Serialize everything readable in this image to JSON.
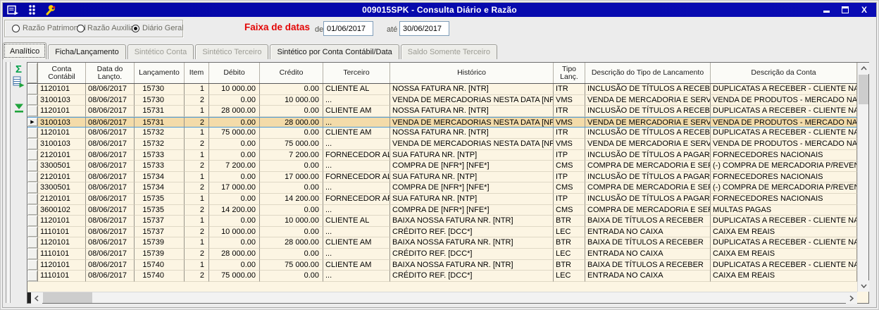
{
  "window": {
    "title": "009015SPK - Consulta Diário e Razão"
  },
  "filters": {
    "radios": [
      {
        "label": "Razão Patrimonial",
        "selected": false
      },
      {
        "label": "Razão Auxiliar",
        "selected": false
      },
      {
        "label": "Diário Geral",
        "selected": true
      }
    ],
    "date_range": {
      "title": "Faixa de datas",
      "from_label": "de",
      "from_value": "01/06/2017",
      "to_label": "até",
      "to_value": "30/06/2017"
    }
  },
  "tabs": [
    {
      "label": "Analítico",
      "state": "selected"
    },
    {
      "label": "Ficha/Lançamento",
      "state": "normal"
    },
    {
      "label": "Sintético Conta",
      "state": "disabled"
    },
    {
      "label": "Sintético Terceiro",
      "state": "disabled"
    },
    {
      "label": "Sintético por Conta Contábil/Data",
      "state": "normal"
    },
    {
      "label": "Saldo Somente Terceiro",
      "state": "disabled"
    }
  ],
  "toolbar": {
    "icons": [
      {
        "name": "sum-sigma-icon"
      },
      {
        "name": "export-grid-icon"
      },
      {
        "name": "collapse-funnel-icon"
      }
    ]
  },
  "grid": {
    "columns": [
      "",
      "Conta Contábil",
      "Data do Lançto.",
      "Lançamento",
      "Item",
      "Débito",
      "Crédito",
      "Terceiro",
      "Histórico",
      "Tipo Lanç.",
      "Descrição do Tipo de Lancamento",
      "Descrição da Conta"
    ],
    "selected_row_index": 3,
    "rows": [
      [
        "1120101",
        "08/06/2017",
        "15730",
        "1",
        "10 000.00",
        "0.00",
        "CLIENTE AL",
        "NOSSA FATURA NR. [NTR]",
        "ITR",
        "INCLUSÃO DE TÍTULOS A RECEBER",
        "DUPLICATAS A RECEBER - CLIENTE NACIONAL"
      ],
      [
        "3100103",
        "08/06/2017",
        "15730",
        "2",
        "0.00",
        "10 000.00",
        "...",
        "VENDA DE MERCADORIAS NESTA DATA [NFS*]",
        "VMS",
        "VENDA DE MERCADORIA E SERVIÇO",
        "VENDA DE PRODUTOS - MERCADO NACIONAL"
      ],
      [
        "1120101",
        "08/06/2017",
        "15731",
        "1",
        "28 000.00",
        "0.00",
        "CLIENTE AM",
        "NOSSA FATURA NR. [NTR]",
        "ITR",
        "INCLUSÃO DE TÍTULOS A RECEBER",
        "DUPLICATAS A RECEBER - CLIENTE NACIONAL"
      ],
      [
        "3100103",
        "08/06/2017",
        "15731",
        "2",
        "0.00",
        "28 000.00",
        "...",
        "VENDA DE MERCADORIAS NESTA DATA [NFS*]",
        "VMS",
        "VENDA DE MERCADORIA E SERVIÇO",
        "VENDA DE PRODUTOS - MERCADO NACIONAL"
      ],
      [
        "1120101",
        "08/06/2017",
        "15732",
        "1",
        "75 000.00",
        "0.00",
        "CLIENTE AM",
        "NOSSA FATURA NR. [NTR]",
        "ITR",
        "INCLUSÃO DE TÍTULOS A RECEBER",
        "DUPLICATAS A RECEBER - CLIENTE NACIONAL"
      ],
      [
        "3100103",
        "08/06/2017",
        "15732",
        "2",
        "0.00",
        "75 000.00",
        "...",
        "VENDA DE MERCADORIAS NESTA DATA [NFS*]",
        "VMS",
        "VENDA DE MERCADORIA E SERVIÇO",
        "VENDA DE PRODUTOS - MERCADO NACIONAL"
      ],
      [
        "2120101",
        "08/06/2017",
        "15733",
        "1",
        "0.00",
        "7 200.00",
        "FORNECEDOR AL",
        "SUA FATURA NR. [NTP]",
        "ITP",
        "INCLUSÃO DE TÍTULOS A PAGAR",
        "FORNECEDORES NACIONAIS"
      ],
      [
        "3300501",
        "08/06/2017",
        "15733",
        "2",
        "7 200.00",
        "0.00",
        "...",
        "COMPRA DE [NFR*] [NFE*]",
        "CMS",
        "COMPRA DE MERCADORIA E SERVIÇO",
        "(-) COMPRA DE MERCADORIA P/REVENDA"
      ],
      [
        "2120101",
        "08/06/2017",
        "15734",
        "1",
        "0.00",
        "17 000.00",
        "FORNECEDOR AL",
        "SUA FATURA NR. [NTP]",
        "ITP",
        "INCLUSÃO DE TÍTULOS A PAGAR",
        "FORNECEDORES NACIONAIS"
      ],
      [
        "3300501",
        "08/06/2017",
        "15734",
        "2",
        "17 000.00",
        "0.00",
        "...",
        "COMPRA DE [NFR*] [NFE*]",
        "CMS",
        "COMPRA DE MERCADORIA E SERVIÇO",
        "(-) COMPRA DE MERCADORIA P/REVENDA"
      ],
      [
        "2120101",
        "08/06/2017",
        "15735",
        "1",
        "0.00",
        "14 200.00",
        "FORNECEDOR AP",
        "SUA FATURA NR. [NTP]",
        "ITP",
        "INCLUSÃO DE TÍTULOS A PAGAR",
        "FORNECEDORES NACIONAIS"
      ],
      [
        "3600102",
        "08/06/2017",
        "15735",
        "2",
        "14 200.00",
        "0.00",
        "...",
        "COMPRA DE [NFR*] [NFE*]",
        "CMS",
        "COMPRA DE MERCADORIA E SERVIÇO",
        "MULTAS PAGAS"
      ],
      [
        "1120101",
        "08/06/2017",
        "15737",
        "1",
        "0.00",
        "10 000.00",
        "CLIENTE AL",
        "BAIXA NOSSA FATURA NR. [NTR]",
        "BTR",
        "BAIXA DE TÍTULOS A RECEBER",
        "DUPLICATAS A RECEBER - CLIENTE NACIONAL"
      ],
      [
        "1110101",
        "08/06/2017",
        "15737",
        "2",
        "10 000.00",
        "0.00",
        "...",
        "CRÉDITO REF. [DCC*]",
        "LEC",
        "ENTRADA NO CAIXA",
        "CAIXA EM REAIS"
      ],
      [
        "1120101",
        "08/06/2017",
        "15739",
        "1",
        "0.00",
        "28 000.00",
        "CLIENTE AM",
        "BAIXA NOSSA FATURA NR. [NTR]",
        "BTR",
        "BAIXA DE TÍTULOS A RECEBER",
        "DUPLICATAS A RECEBER - CLIENTE NACIONAL"
      ],
      [
        "1110101",
        "08/06/2017",
        "15739",
        "2",
        "28 000.00",
        "0.00",
        "...",
        "CRÉDITO REF. [DCC*]",
        "LEC",
        "ENTRADA NO CAIXA",
        "CAIXA EM REAIS"
      ],
      [
        "1120101",
        "08/06/2017",
        "15740",
        "1",
        "0.00",
        "75 000.00",
        "CLIENTE AM",
        "BAIXA NOSSA FATURA NR. [NTR]",
        "BTR",
        "BAIXA DE TÍTULOS A RECEBER",
        "DUPLICATAS A RECEBER - CLIENTE NACIONAL"
      ],
      [
        "1110101",
        "08/06/2017",
        "15740",
        "2",
        "75 000.00",
        "0.00",
        "...",
        "CRÉDITO REF. [DCC*]",
        "LEC",
        "ENTRADA NO CAIXA",
        "CAIXA EM REAIS"
      ]
    ]
  },
  "colors": {
    "titlebar": "#0406A6",
    "accent_red": "#E30505",
    "row_bg": "#FCF5E3",
    "row_selected_bg": "#F3DBA9",
    "row_selected_border": "#4F9BD5",
    "icon_green": "#00A14B"
  }
}
